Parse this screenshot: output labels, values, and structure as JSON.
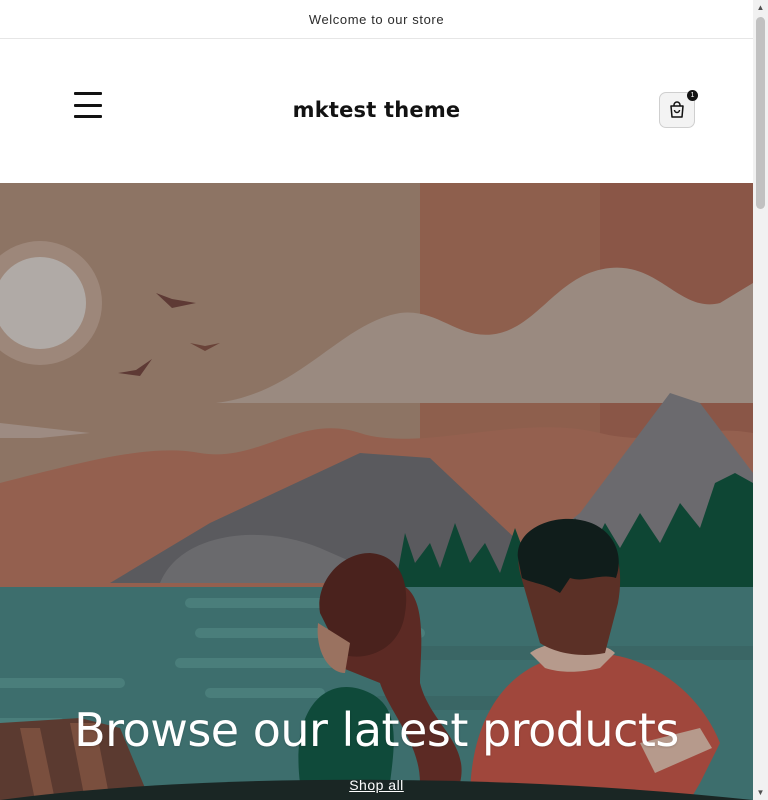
{
  "announcement": {
    "text": "Welcome to our store"
  },
  "header": {
    "logo_text": "mktest theme",
    "menu_icon": "hamburger-icon",
    "cart_icon": "shopping-bag-icon",
    "cart_count": "1"
  },
  "hero": {
    "title": "Browse our latest products",
    "link_text": "Shop all",
    "image": "illustration-couple-looking-at-lake-and-mountains"
  },
  "colors": {
    "accent": "#121212",
    "hero_sky": "#9a7260",
    "hero_water": "#3f6f6d"
  }
}
